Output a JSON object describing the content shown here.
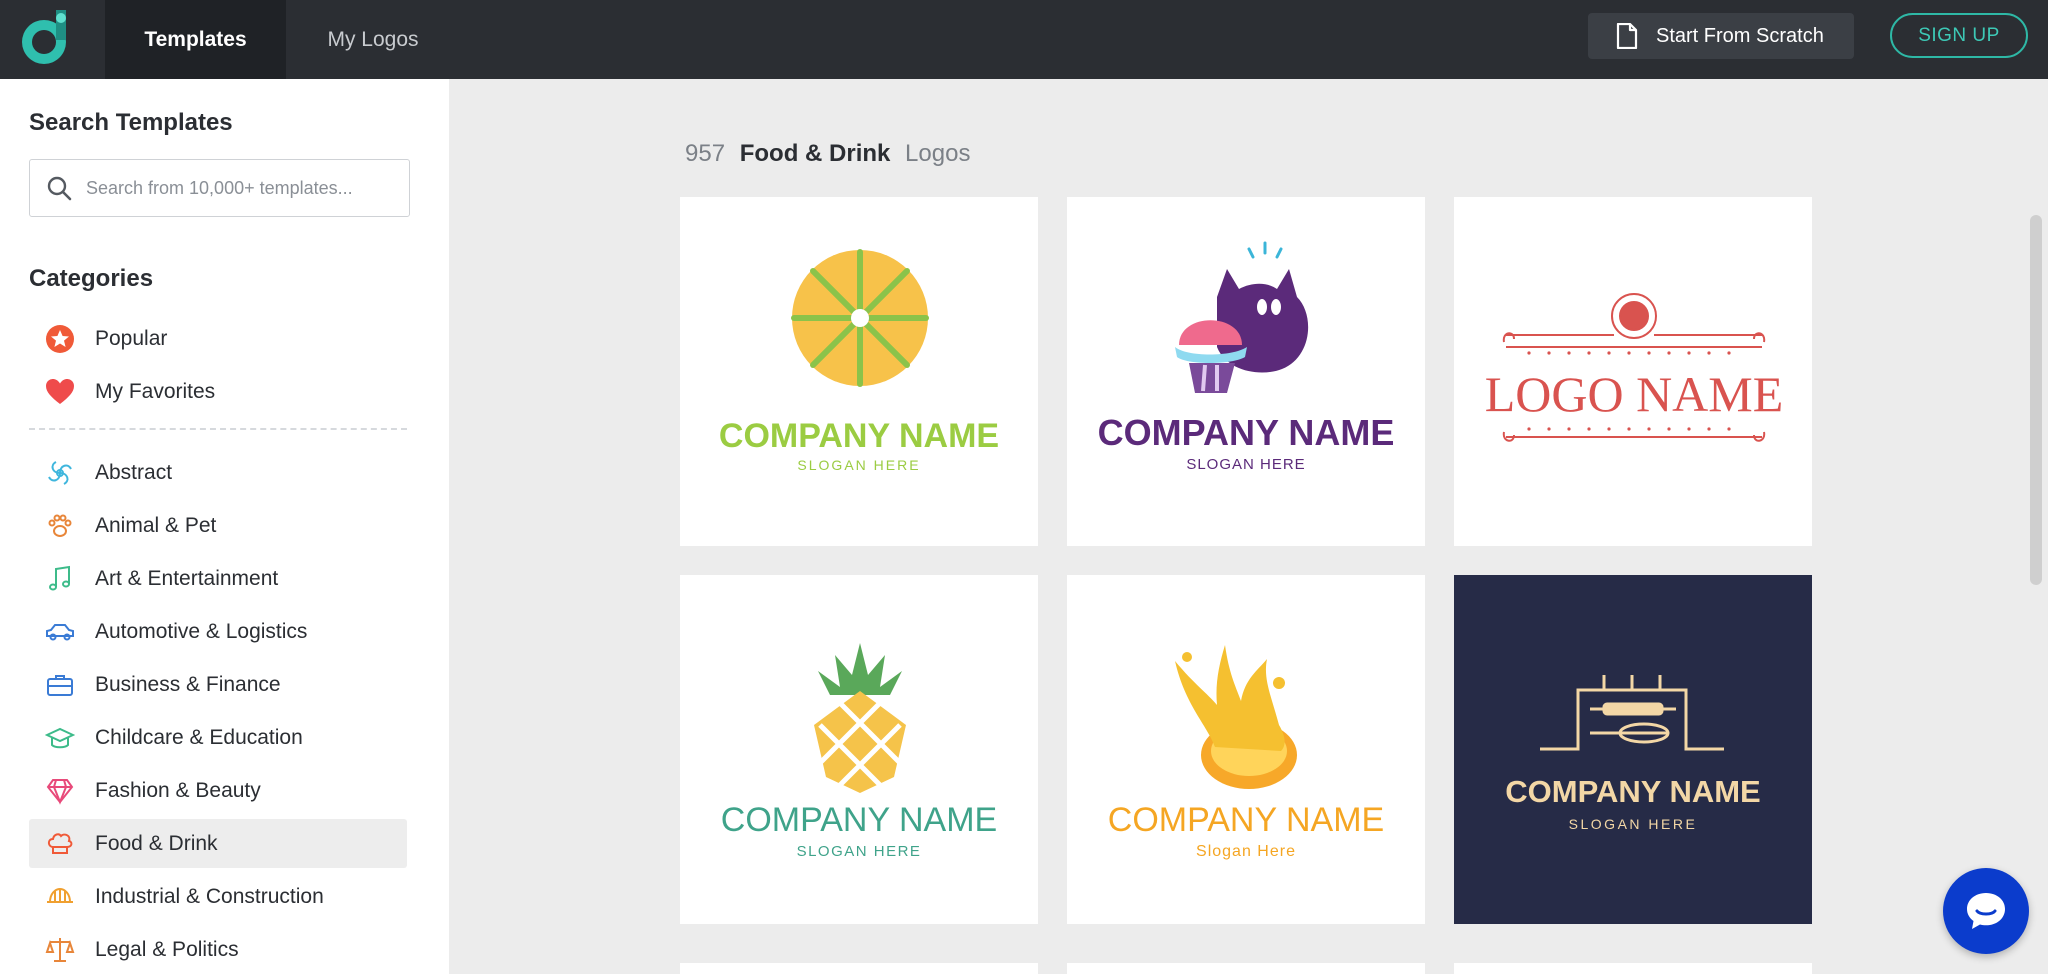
{
  "header": {
    "logo_icon": "brand-logo-icon",
    "tabs": [
      {
        "label": "Templates",
        "active": true
      },
      {
        "label": "My Logos",
        "active": false
      }
    ],
    "start_from_scratch_label": "Start From Scratch",
    "signup_label": "SIGN UP"
  },
  "sidebar": {
    "search_heading": "Search Templates",
    "search_placeholder": "Search from 10,000+ templates...",
    "categories_heading": "Categories",
    "pinned": [
      {
        "label": "Popular",
        "icon": "star-badge-icon",
        "color": "#f05a38"
      },
      {
        "label": "My Favorites",
        "icon": "heart-icon",
        "color": "#ef4b4b"
      }
    ],
    "categories": [
      {
        "label": "Abstract",
        "icon": "swirl-icon",
        "color": "#3fb6dd",
        "active": false
      },
      {
        "label": "Animal & Pet",
        "icon": "paw-icon",
        "color": "#e8863a",
        "active": false
      },
      {
        "label": "Art & Entertainment",
        "icon": "music-note-icon",
        "color": "#3dbb8a",
        "active": false
      },
      {
        "label": "Automotive & Logistics",
        "icon": "car-icon",
        "color": "#3a7bd5",
        "active": false
      },
      {
        "label": "Business & Finance",
        "icon": "briefcase-icon",
        "color": "#3a7bd5",
        "active": false
      },
      {
        "label": "Childcare & Education",
        "icon": "graduation-cap-icon",
        "color": "#3dbb8a",
        "active": false
      },
      {
        "label": "Fashion & Beauty",
        "icon": "diamond-icon",
        "color": "#e84a7a",
        "active": false
      },
      {
        "label": "Food & Drink",
        "icon": "chef-hat-icon",
        "color": "#f05a38",
        "active": true
      },
      {
        "label": "Industrial & Construction",
        "icon": "hard-hat-icon",
        "color": "#f0a030",
        "active": false
      },
      {
        "label": "Legal & Politics",
        "icon": "scales-icon",
        "color": "#e8863a",
        "active": false
      }
    ]
  },
  "main": {
    "count": "957",
    "category": "Food & Drink",
    "suffix": "Logos",
    "templates": [
      {
        "title": "COMPANY NAME",
        "slogan": "SLOGAN HERE",
        "title_color": "#9bcc42",
        "slogan_color": "#9bcc42",
        "theme": "citrus-slice"
      },
      {
        "title": "COMPANY NAME",
        "slogan": "SLOGAN HERE",
        "title_color": "#5b2a7a",
        "slogan_color": "#5b2a7a",
        "theme": "cat-cupcake"
      },
      {
        "title": "LOGO NAME",
        "slogan": "",
        "title_color": "#d9534f",
        "slogan_color": "#d9534f",
        "theme": "vintage-frame"
      },
      {
        "title": "COMPANY NAME",
        "slogan": "SLOGAN HERE",
        "title_color": "#3fa38a",
        "slogan_color": "#3fa38a",
        "theme": "pineapple"
      },
      {
        "title": "COMPANY NAME",
        "slogan": "Slogan Here",
        "title_color": "#f5a623",
        "slogan_color": "#f5a623",
        "theme": "juice-splash"
      },
      {
        "title": "COMPANY NAME",
        "slogan": "SLOGAN HERE",
        "title_color": "#f3d7a6",
        "slogan_color": "#f3d7a6",
        "theme": "bakery-tools"
      }
    ]
  },
  "chat": {
    "icon": "chat-bubble-icon"
  }
}
